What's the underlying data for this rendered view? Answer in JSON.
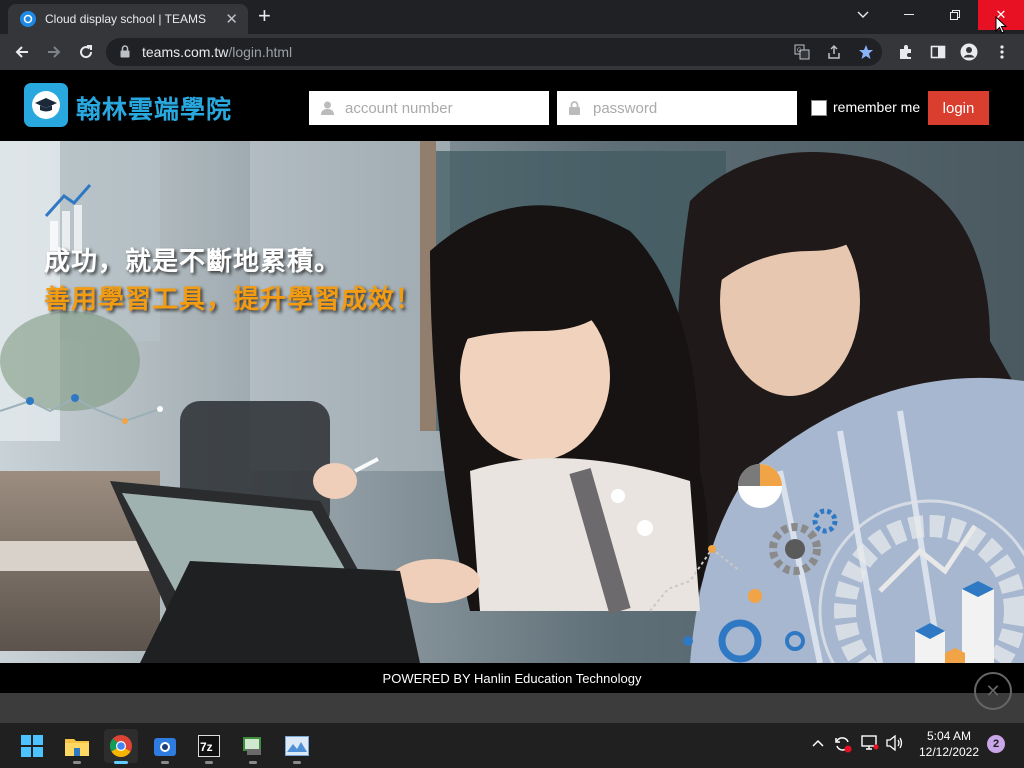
{
  "browser": {
    "tab_title": "Cloud display school | TEAMS",
    "url_host": "teams.com.tw",
    "url_path": "/login.html"
  },
  "site": {
    "logo_text": "翰林雲端學院",
    "account_placeholder": "account number",
    "password_placeholder": "password",
    "remember_label": "remember me",
    "login_label": "login",
    "tagline_line1": "成功，就是不斷地累積。",
    "tagline_line2": "善用學習工具，提升學習成效！",
    "footer_text": "POWERED BY Hanlin Education Technology",
    "colors": {
      "accent_blue": "#29a8e0",
      "login_red": "#d93e2e",
      "tagline_orange": "#f39c12"
    }
  },
  "taskbar": {
    "apps": [
      "windows-start",
      "file-explorer",
      "chrome",
      "camera-app",
      "7zip",
      "image-viewer",
      "photo-app"
    ],
    "time": "5:04 AM",
    "date": "12/12/2022",
    "notification_count": "2"
  }
}
